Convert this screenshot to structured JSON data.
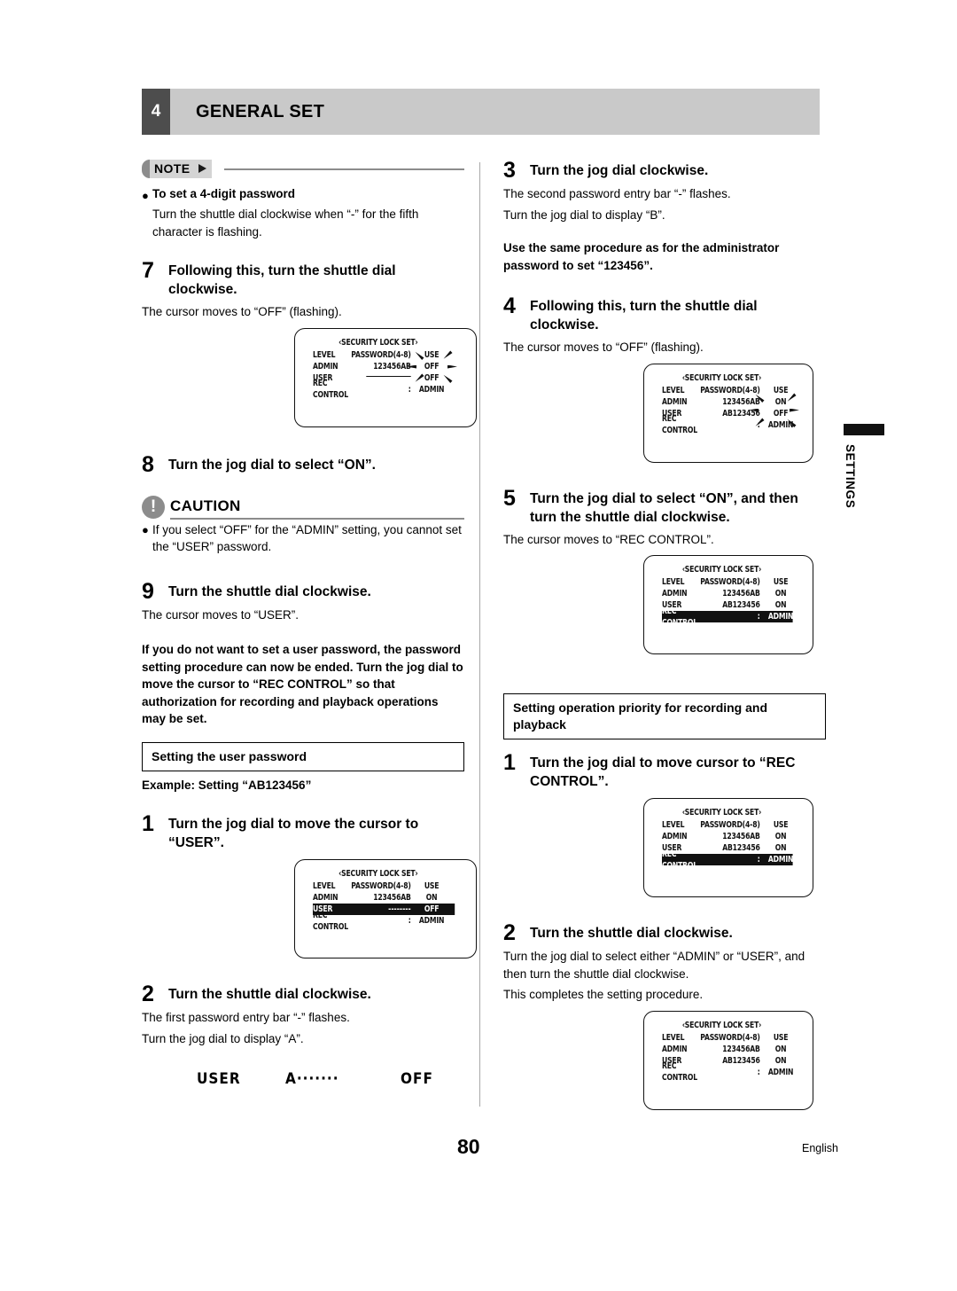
{
  "header": {
    "chapter_number": "4",
    "title": "GENERAL SET"
  },
  "side_tab": {
    "label": "SETTINGS"
  },
  "footer": {
    "page_number": "80",
    "language": "English"
  },
  "left_column": {
    "note": {
      "label": "NOTE",
      "bullet_heading": "To set a 4-digit password",
      "body": "Turn the shuttle dial clockwise when “-” for the fifth character is flashing."
    },
    "step7": {
      "number": "7",
      "title": "Following this, turn the shuttle dial clockwise.",
      "desc": "The cursor moves to “OFF” (flashing)."
    },
    "osd7": {
      "title": "‹SECURITY LOCK SET›",
      "rows": [
        {
          "label": "LEVEL",
          "value": "PASSWORD(4-8)",
          "state": "USE"
        },
        {
          "label": "ADMIN",
          "value": "123456AB",
          "state": "OFF"
        },
        {
          "label": "USER",
          "value": "",
          "state": "OFF"
        },
        {
          "label": "REC CONTROL",
          "value": ":",
          "state": "ADMIN"
        }
      ]
    },
    "step8": {
      "number": "8",
      "title": "Turn the jog dial to select “ON”."
    },
    "caution": {
      "label": "CAUTION",
      "icon": "!",
      "body": "If you select “OFF” for the “ADMIN” setting, you cannot set the “USER” password."
    },
    "step9": {
      "number": "9",
      "title": "Turn the shuttle dial clockwise.",
      "desc": "The cursor moves to “USER”."
    },
    "note_paragraph": "If you do not want to set a user password, the password setting procedure can now be ended. Turn the jog dial to move the cursor to “REC CONTROL” so that authorization for recording and playback operations may be set.",
    "section_user_password": "Setting the user password",
    "example_line": "Example: Setting “AB123456”",
    "step1": {
      "number": "1",
      "title": "Turn the jog dial to move the cursor to “USER”."
    },
    "osd1": {
      "title": "‹SECURITY LOCK SET›",
      "rows": [
        {
          "label": "LEVEL",
          "value": "PASSWORD(4-8)",
          "state": "USE",
          "highlight": false
        },
        {
          "label": "ADMIN",
          "value": "123456AB",
          "state": "ON",
          "highlight": false
        },
        {
          "label": "USER",
          "value": "--------",
          "state": "OFF",
          "highlight": true
        },
        {
          "label": "REC CONTROL",
          "value": ":",
          "state": "ADMIN",
          "highlight": false
        }
      ]
    },
    "step2": {
      "number": "2",
      "title": "Turn the shuttle dial clockwise.",
      "desc_line1": "The first password entry bar “-” flashes.",
      "desc_line2": "Turn the jog dial to display “A”."
    },
    "sample_line": {
      "label": "USER",
      "value": "A·······",
      "state": "OFF"
    }
  },
  "right_column": {
    "step3": {
      "number": "3",
      "title": "Turn the jog dial clockwise.",
      "desc_line1": "The second password entry bar “-” flashes.",
      "desc_line2": "Turn the jog dial to display “B”."
    },
    "note_bold": "Use the same procedure as for the administrator password to set “123456”.",
    "step4": {
      "number": "4",
      "title": "Following this, turn the shuttle dial clockwise.",
      "desc": "The cursor moves to “OFF” (flashing)."
    },
    "osd4": {
      "title": "‹SECURITY LOCK SET›",
      "rows": [
        {
          "label": "LEVEL",
          "value": "PASSWORD(4-8)",
          "state": "USE"
        },
        {
          "label": "ADMIN",
          "value": "123456AB",
          "state": "ON"
        },
        {
          "label": "USER",
          "value": "AB123456",
          "state": "OFF"
        },
        {
          "label": "REC CONTROL",
          "value": ":",
          "state": "ADMIN"
        }
      ]
    },
    "step5": {
      "number": "5",
      "title": "Turn the jog dial to select “ON”, and then turn the shuttle dial clockwise.",
      "desc": "The cursor moves to “REC CONTROL”."
    },
    "osd5": {
      "title": "‹SECURITY LOCK SET›",
      "rows": [
        {
          "label": "LEVEL",
          "value": "PASSWORD(4-8)",
          "state": "USE",
          "highlight": false
        },
        {
          "label": "ADMIN",
          "value": "123456AB",
          "state": "ON",
          "highlight": false
        },
        {
          "label": "USER",
          "value": "AB123456",
          "state": "ON",
          "highlight": false
        },
        {
          "label": "REC CONTROL",
          "value": ":",
          "state": "ADMIN",
          "highlight": true
        }
      ]
    },
    "section_rec_priority": "Setting operation priority for recording and playback",
    "step1": {
      "number": "1",
      "title": "Turn the jog dial to move cursor to “REC CONTROL”."
    },
    "osd_r1": {
      "title": "‹SECURITY LOCK SET›",
      "rows": [
        {
          "label": "LEVEL",
          "value": "PASSWORD(4-8)",
          "state": "USE",
          "highlight": false
        },
        {
          "label": "ADMIN",
          "value": "123456AB",
          "state": "ON",
          "highlight": false
        },
        {
          "label": "USER",
          "value": "AB123456",
          "state": "ON",
          "highlight": false
        },
        {
          "label": "REC CONTROL",
          "value": ":",
          "state": "ADMIN",
          "highlight": true
        }
      ]
    },
    "step2b": {
      "number": "2",
      "title": "Turn the shuttle dial clockwise.",
      "desc_line1": "Turn the jog dial to select either “ADMIN” or “USER”, and then turn the shuttle dial clockwise.",
      "desc_line2": "This completes the setting procedure."
    },
    "osd_r2": {
      "title": "‹SECURITY LOCK SET›",
      "rows": [
        {
          "label": "LEVEL",
          "value": "PASSWORD(4-8)",
          "state": "USE",
          "highlight": false
        },
        {
          "label": "ADMIN",
          "value": "123456AB",
          "state": "ON",
          "highlight": false
        },
        {
          "label": "USER",
          "value": "AB123456",
          "state": "ON",
          "highlight": false
        },
        {
          "label": "REC CONTROL",
          "value": ":",
          "state": "ADMIN",
          "highlight": false
        }
      ]
    }
  }
}
